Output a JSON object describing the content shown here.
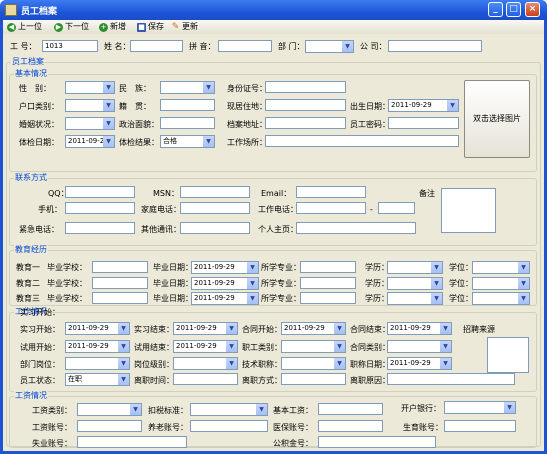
{
  "window": {
    "title": "员工档案"
  },
  "toolbar": {
    "prev": "上一位",
    "next": "下一位",
    "new": "新增",
    "save": "保存",
    "update": "更新"
  },
  "top": {
    "emp_no_label": "工 号：",
    "emp_no_value": "1013",
    "name_label": "姓 名：",
    "pinyin_label": "拼 音：",
    "dept_label": "部 门：",
    "company_label": "公 司："
  },
  "archive": {
    "title": "员工档案"
  },
  "basic": {
    "title": "基本情况",
    "gender": "性　别：",
    "ethnic": "民　族：",
    "id_no": "身份证号：",
    "hukou": "户口类别：",
    "native": "籍　贯：",
    "address": "现居住地：",
    "birth": "出生日期：",
    "birth_value": "2011-09-29",
    "marital": "婚姻状况：",
    "political": "政治面貌：",
    "archive_addr": "档案地址：",
    "emp_pwd": "员工密码：",
    "exam_date": "体检日期：",
    "exam_date_value": "2011-09-29",
    "exam_result": "体检结果：",
    "exam_result_value": "合格",
    "workplace": "工作场所：",
    "photo_button": "双击选择图片"
  },
  "contact": {
    "title": "联系方式",
    "qq": "QQ：",
    "msn": "MSN：",
    "email": "Email：",
    "remark": "备注",
    "mobile": "手机：",
    "home_phone": "家庭电话：",
    "work_phone": "工作电话：",
    "dash": "-",
    "emergency": "紧急电话：",
    "other": "其他通讯：",
    "homepage": "个人主页："
  },
  "education": {
    "title": "教育经历",
    "rows": [
      {
        "label": "教育一",
        "school": "毕业学校：",
        "date": "毕业日期：",
        "date_value": "2011-09-29",
        "major": "所学专业：",
        "degree": "学历：",
        "xuewei": "学位："
      },
      {
        "label": "教育二",
        "school": "毕业学校：",
        "date": "毕业日期：",
        "date_value": "2011-09-29",
        "major": "所学专业：",
        "degree": "学历：",
        "xuewei": "学位："
      },
      {
        "label": "教育三",
        "school": "毕业学校：",
        "date": "毕业日期：",
        "date_value": "2011-09-29",
        "major": "所学专业：",
        "degree": "学历：",
        "xuewei": "学位："
      }
    ]
  },
  "work": {
    "title": "工作情况",
    "intern_start": "实习开始：",
    "intern_start_value": "2011-09-29",
    "intern_end": "实习结束：",
    "intern_end_value": "2011-09-29",
    "contract_start": "合同开始：",
    "contract_start_value": "2011-09-29",
    "contract_end": "合同结束：",
    "contract_end_value": "2011-09-29",
    "hire_source": "招聘来源",
    "trial_start": "试用开始：",
    "trial_start_value": "2011-09-29",
    "trial_end": "试用结束：",
    "trial_end_value": "2011-09-29",
    "job_type": "职工类别：",
    "contract_type": "合同类别：",
    "dept_post": "部门岗位：",
    "post_level": "岗位级别：",
    "tech_title": "技术职称：",
    "title_date": "职称日期：",
    "title_date_value": "2011-09-29",
    "status": "员工状态：",
    "status_value": "在职",
    "leave_time": "离职时间：",
    "leave_mode": "离职方式：",
    "leave_reason": "离职原因："
  },
  "salary": {
    "title": "工资情况",
    "wage_type": "工资类别：",
    "tax_std": "扣税标准：",
    "base_wage": "基本工资：",
    "bank": "开户银行：",
    "wage_acct": "工资账号：",
    "pension_acct": "养老账号：",
    "medical_acct": "医保账号：",
    "maternity_acct": "生育账号：",
    "unemploy_acct": "失业账号：",
    "fund_acct": "公积金号："
  }
}
